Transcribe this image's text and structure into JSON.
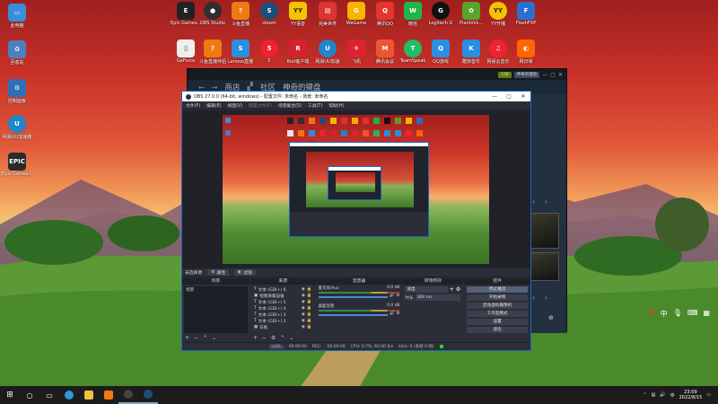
{
  "desktop_icons": [
    {
      "id": "computer",
      "label": "此电脑",
      "color": "#3a8fd9"
    },
    {
      "id": "recycle",
      "label": "回收站",
      "color": "#4a80c0"
    },
    {
      "id": "control",
      "label": "控制面板",
      "color": "#2f6fb8"
    },
    {
      "id": "netease",
      "label": "网易UU加速器",
      "color": "#1f86c9"
    },
    {
      "id": "epic",
      "label": "Epic Games Launcher",
      "color": "#2a2a2a"
    }
  ],
  "top_row_icons": [
    {
      "label": "Epic Games...",
      "color": "#222"
    },
    {
      "label": "OBS Studio",
      "color": "#302e31"
    },
    {
      "label": "斗鱼直播",
      "color": "#f07a12"
    },
    {
      "label": "steam",
      "color": "#1b4f7a"
    },
    {
      "label": "YY语音",
      "color": "#f3c300"
    },
    {
      "label": "完美世界",
      "color": "#d33"
    },
    {
      "label": "WeGame",
      "color": "#f7b500"
    },
    {
      "label": "腾讯QQ",
      "color": "#e5352f"
    },
    {
      "label": "微信",
      "color": "#20b54c"
    },
    {
      "label": "Logitech G",
      "color": "#111"
    },
    {
      "label": "PlantsVs...",
      "color": "#5aa32a"
    },
    {
      "label": "YY开播",
      "color": "#f3c300"
    },
    {
      "label": "FlashFXP",
      "color": "#2b6fd2"
    }
  ],
  "second_row_icons": [
    {
      "label": "GeForce",
      "color": "#eee"
    },
    {
      "label": "斗鱼直播伴侣",
      "color": "#f07a12"
    },
    {
      "label": "Lenovo直播",
      "color": "#2a8fe0"
    },
    {
      "label": "5",
      "color": "#e23"
    },
    {
      "label": "Riot客户端",
      "color": "#d6202f"
    },
    {
      "label": "网易UU加速",
      "color": "#1f86c9"
    },
    {
      "label": "飞机",
      "color": "#d23"
    },
    {
      "label": "腾讯会议",
      "color": "#e53"
    },
    {
      "label": "TeamSpeak",
      "color": "#2b6"
    },
    {
      "label": "QQ游戏",
      "color": "#2a8fe0"
    },
    {
      "label": "酷狗音乐",
      "color": "#2a8fe0"
    },
    {
      "label": "网易云音乐",
      "color": "#e23"
    },
    {
      "label": "网日常",
      "color": "#f60"
    }
  ],
  "steam": {
    "nav": [
      "商店",
      "社区",
      "神奇的键盘"
    ],
    "badge_count": "158",
    "user": "神奇的键盘"
  },
  "obs": {
    "title": "OBS 27.0.0 (64-bit, windows) - 配置文件: 未命名 - 场景: 未命名",
    "menu": [
      "文件(F)",
      "编辑(E)",
      "视图(V)",
      "配置文件(P)",
      "场景集合(S)",
      "工具(T)",
      "帮助(H)"
    ],
    "statusline": {
      "source": "未选择源",
      "props": "属性",
      "filters": "滤镜"
    },
    "docks": {
      "scenes": {
        "title": "场景",
        "items": [
          "场景"
        ]
      },
      "sources": {
        "title": "来源",
        "items": [
          "文本 (GDI+) 6",
          "视频采集设备",
          "文本 (GDI+) 5",
          "文本 (GDI+) 4",
          "文本 (GDI+) 3",
          "文本 (GDI+) 2",
          "白板"
        ]
      },
      "mixer": {
        "title": "混音器",
        "items": [
          {
            "name": "麦克风/Aux",
            "db": "0.0 dB"
          },
          {
            "name": "桌面音频",
            "db": "0.0 dB"
          }
        ]
      },
      "transitions": {
        "title": "转场特效",
        "type": "淡出",
        "duration_label": "时长",
        "duration": "300 ms"
      },
      "controls": {
        "title": "控件",
        "buttons": [
          "停止推流",
          "开始录制",
          "启动虚拟摄像机",
          "工作室模式",
          "设置",
          "退出"
        ]
      }
    },
    "status": {
      "live_label": "LIVE:",
      "live_time": "00:00:00",
      "rec_label": "REC:",
      "rec_time": "00:00:00",
      "cpu": "CPU: 0.7%, 60.00 fps",
      "kbps": "kb/s: 0 (丢帧 0 帧)"
    }
  },
  "taskbar": {
    "time": "23:09",
    "date": "2022/8/15"
  }
}
